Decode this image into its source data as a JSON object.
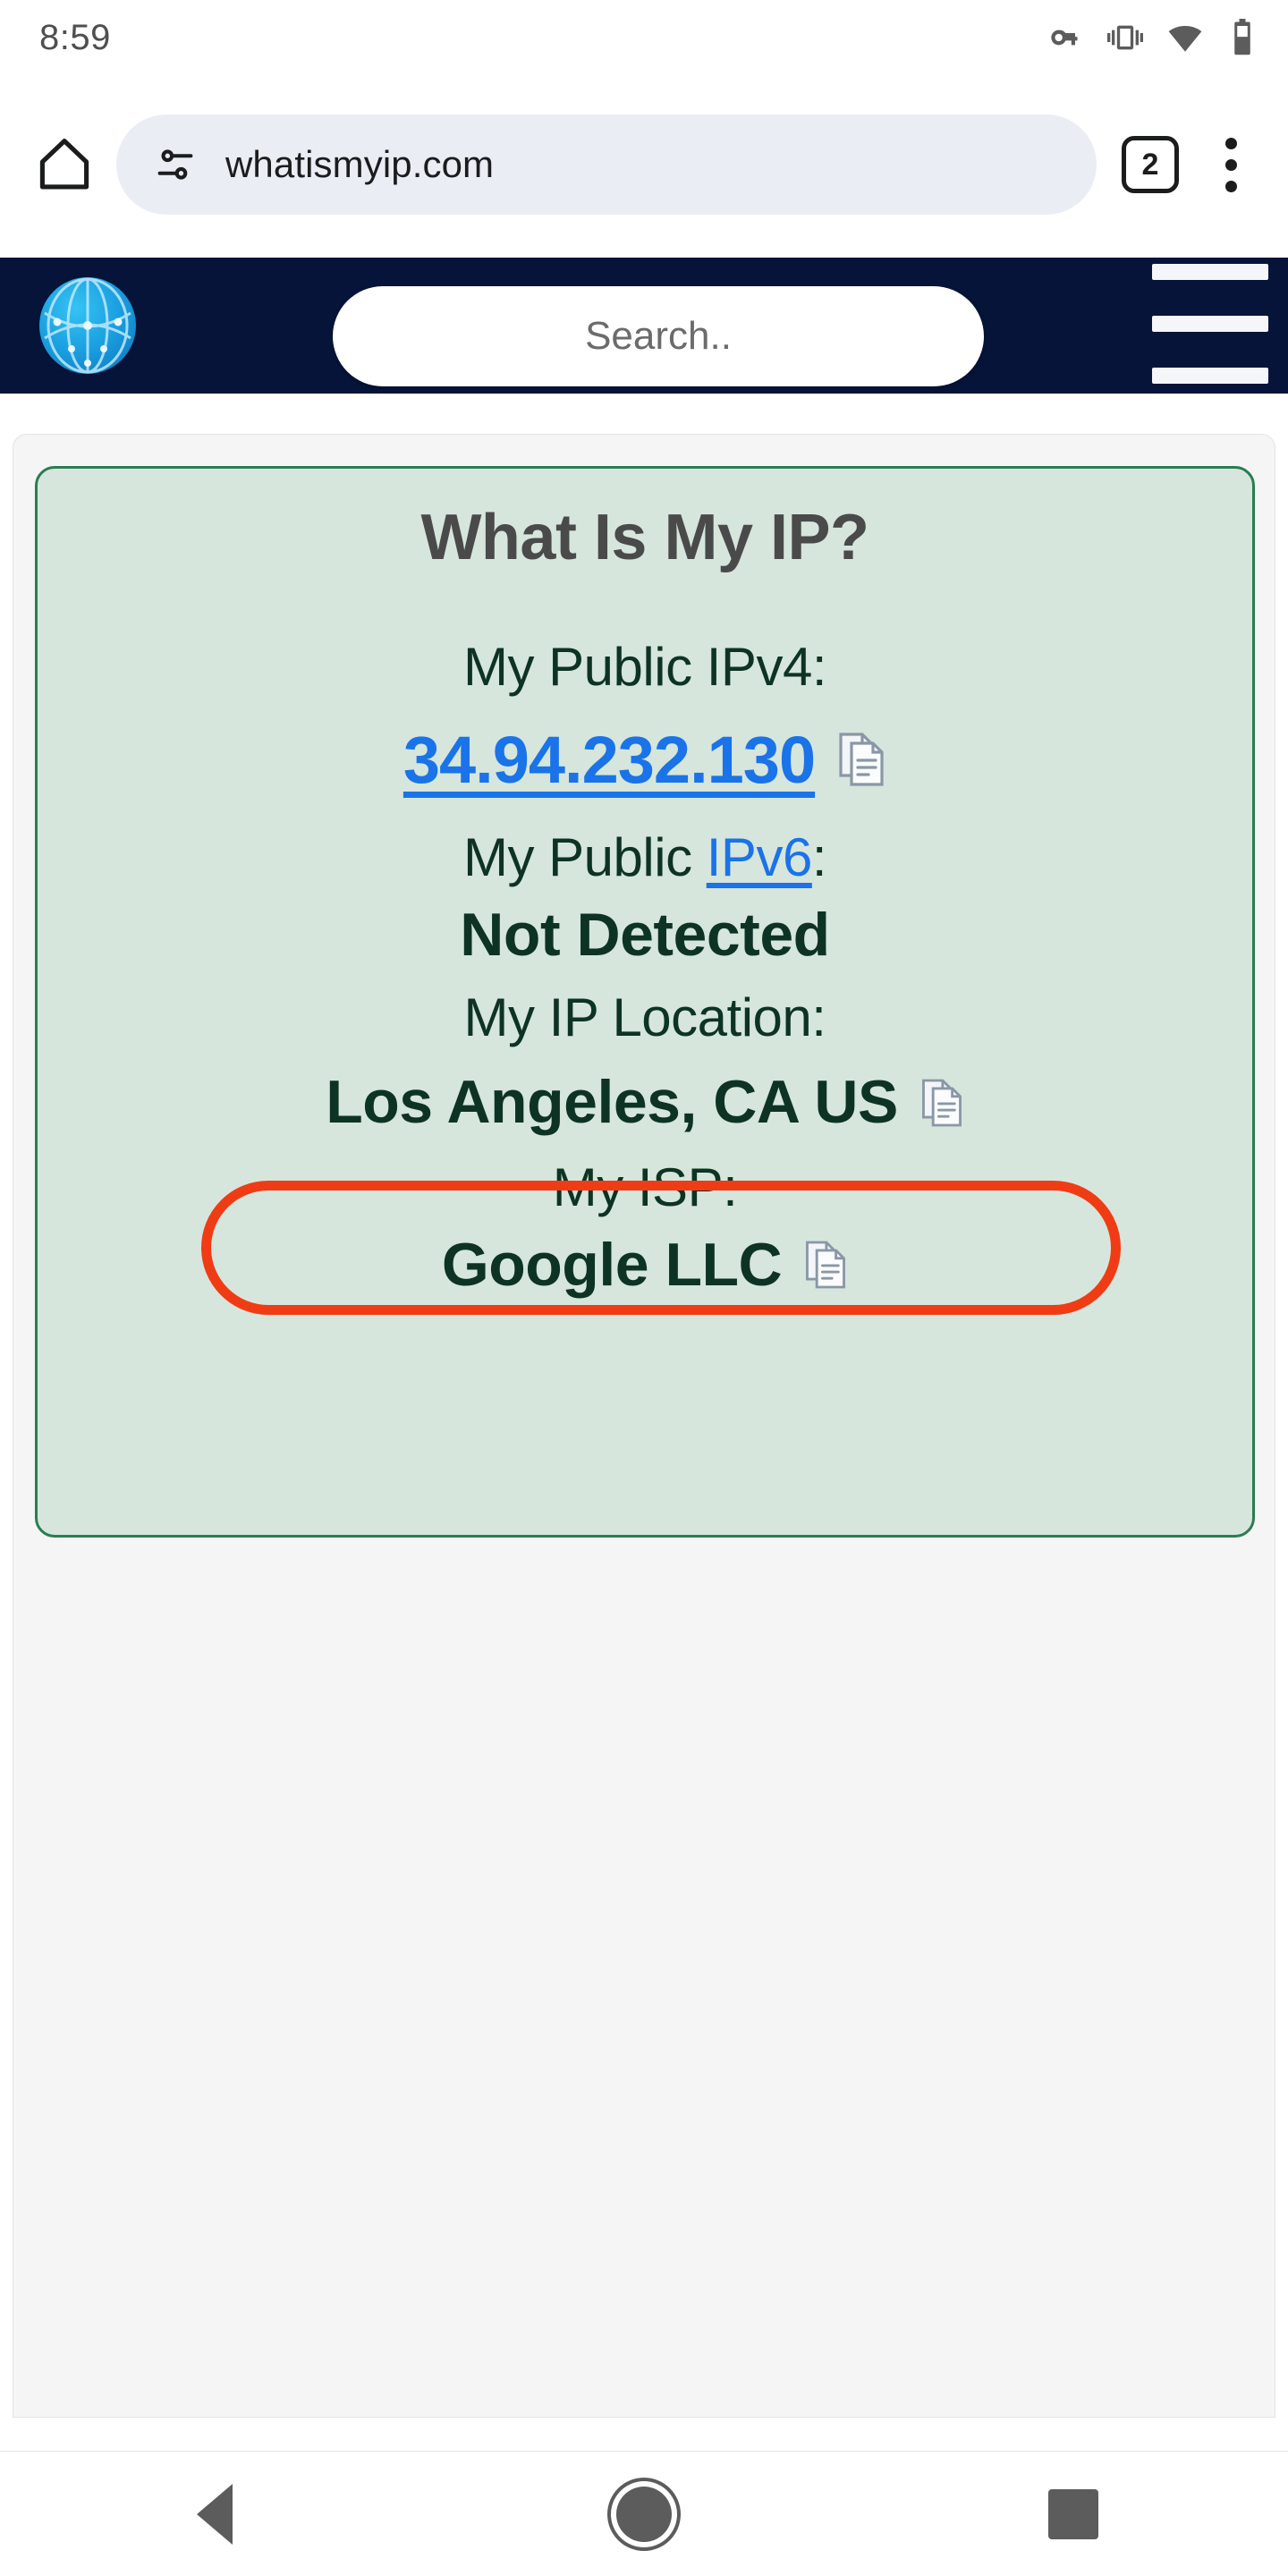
{
  "status_bar": {
    "time": "8:59",
    "icons": [
      "vpn-key-icon",
      "vibrate-icon",
      "wifi-icon",
      "battery-icon"
    ]
  },
  "browser": {
    "home_icon": "home-icon",
    "site_info_icon": "site-settings-icon",
    "url": "whatismyip.com",
    "tab_count": "2",
    "menu_icon": "kebab-menu-icon"
  },
  "site_header": {
    "logo_name": "whatismyip-globe-logo",
    "search_placeholder": "Search..",
    "menu_icon": "hamburger-menu-icon"
  },
  "ip_card": {
    "title": "What Is My IP?",
    "ipv4_label": "My Public IPv4:",
    "ipv4_value": "34.94.232.130",
    "ipv6_label_prefix": "My Public ",
    "ipv6_link": "IPv6",
    "ipv6_label_suffix": ":",
    "ipv6_value": "Not Detected",
    "location_label": "My IP Location:",
    "location_value": "Los Angeles, CA US",
    "isp_label": "My ISP:",
    "isp_value": "Google LLC",
    "copy_icon": "copy-to-clipboard-icon",
    "colors": {
      "card_background": "#d6e6dd",
      "card_border": "#2a7d52",
      "text": "#0d3324",
      "link": "#1a73e8",
      "title": "#4a4a4a",
      "header_background": "#06143a",
      "annotation": "#f03c14"
    }
  },
  "annotation": {
    "target": "location_value",
    "shape": "rounded-rectangle",
    "color": "#f03c14"
  },
  "nav_bar": {
    "back": "back-button",
    "home": "home-button",
    "recents": "recents-button"
  }
}
